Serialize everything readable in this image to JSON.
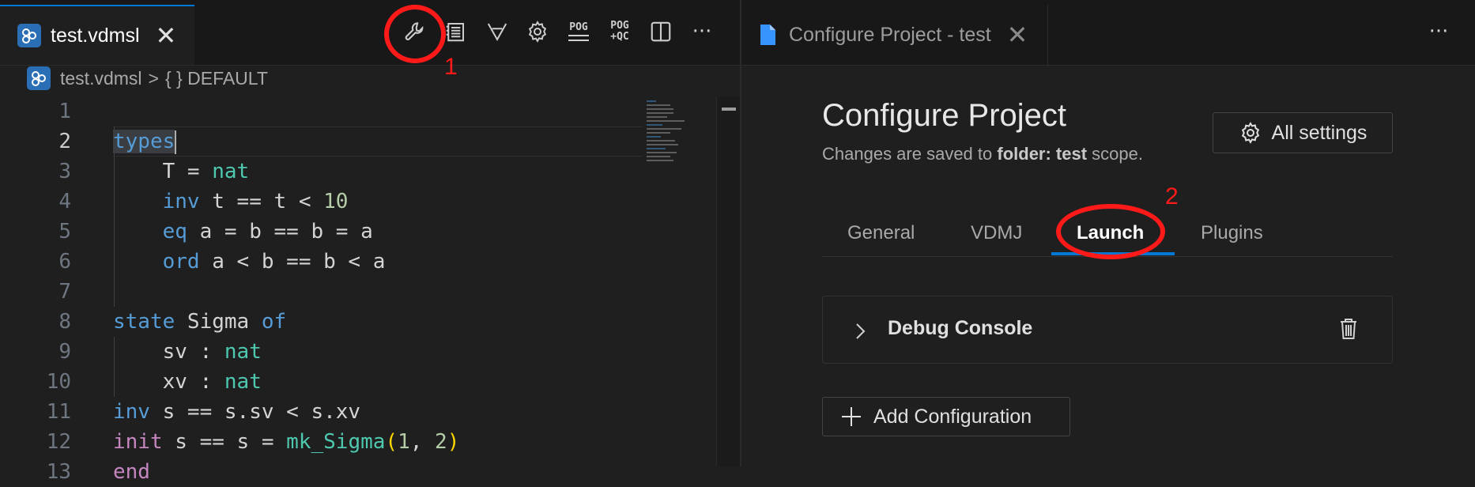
{
  "editor_tab": {
    "label": "test.vdmsl",
    "close": "✕"
  },
  "toolbar": {
    "items": [
      "wrench-icon",
      "book-icon",
      "filter-icon",
      "gear-icon",
      "pog",
      "pog-qc",
      "split-icon",
      "more-icon"
    ],
    "pog_label_top": "POG",
    "pog_label_bottom": "",
    "pogqc_label_top": "POG",
    "pogqc_label_bottom": "+QC",
    "more": "···"
  },
  "annotations": {
    "one": "1",
    "two": "2"
  },
  "breadcrumb": {
    "file": "test.vdmsl",
    "sep": ">",
    "symbol": "{ } DEFAULT"
  },
  "code": {
    "line_numbers": [
      "1",
      "2",
      "3",
      "4",
      "5",
      "6",
      "7",
      "8",
      "9",
      "10",
      "11",
      "12",
      "13"
    ],
    "l2": "types",
    "l3_a": "    T = ",
    "l3_b": "nat",
    "l4_a": "    ",
    "l4_b": "inv",
    "l4_c": " t == t < ",
    "l4_d": "10",
    "l5_a": "    ",
    "l5_b": "eq",
    "l5_c": " a = b == b = a",
    "l6_a": "    ",
    "l6_b": "ord",
    "l6_c": " a < b == b < a",
    "l8_a": "state",
    "l8_b": " Sigma ",
    "l8_c": "of",
    "l9_a": "    sv : ",
    "l9_b": "nat",
    "l10_a": "    xv : ",
    "l10_b": "nat",
    "l11_a": "inv",
    "l11_b": " s == s.sv < s.xv",
    "l12_a": "init",
    "l12_b": " s == s = ",
    "l12_c": "mk_Sigma",
    "l12_d": "(",
    "l12_e": "1",
    "l12_f": ", ",
    "l12_g": "2",
    "l12_h": ")",
    "l13": "end"
  },
  "config_tab": {
    "label": "Configure Project - test",
    "close": "✕"
  },
  "config": {
    "title": "Configure Project",
    "sub_a": "Changes are saved to ",
    "sub_b": "folder: test",
    "sub_c": " scope.",
    "all_settings": "All settings",
    "tabs": [
      "General",
      "VDMJ",
      "Launch",
      "Plugins"
    ],
    "active_tab": "Launch",
    "card_title": "Debug Console",
    "add_configuration": "Add Configuration"
  },
  "colors": {
    "accent": "#0078d4",
    "annotation": "#ff1a1a"
  }
}
